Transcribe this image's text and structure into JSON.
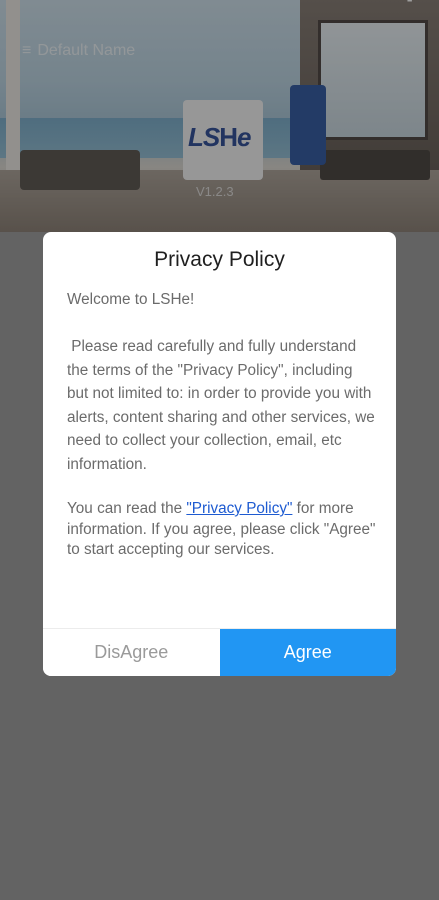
{
  "header": {
    "device_name": "Default Name",
    "version": "V1.2.3"
  },
  "brand": {
    "logo_text": "LSHe"
  },
  "dialog": {
    "title": "Privacy Policy",
    "welcome": "Welcome to LSHe!",
    "intro": " Please read carefully and fully understand the terms of the \"Privacy Policy\", including but not limited to: in order to provide you with alerts, content sharing and other services, we need to collect your collection, email, etc information.",
    "read_prefix": "You can read the ",
    "read_link": "\"Privacy Policy\"",
    "read_suffix": " for more information. If you agree, please click \"Agree\" to start accepting our services.",
    "disagree_label": "DisAgree",
    "agree_label": "Agree"
  },
  "colors": {
    "accent": "#2196f3",
    "link": "#1e5bd1",
    "scrim": "#636363"
  },
  "icons": {
    "menu": "menu-icon"
  }
}
